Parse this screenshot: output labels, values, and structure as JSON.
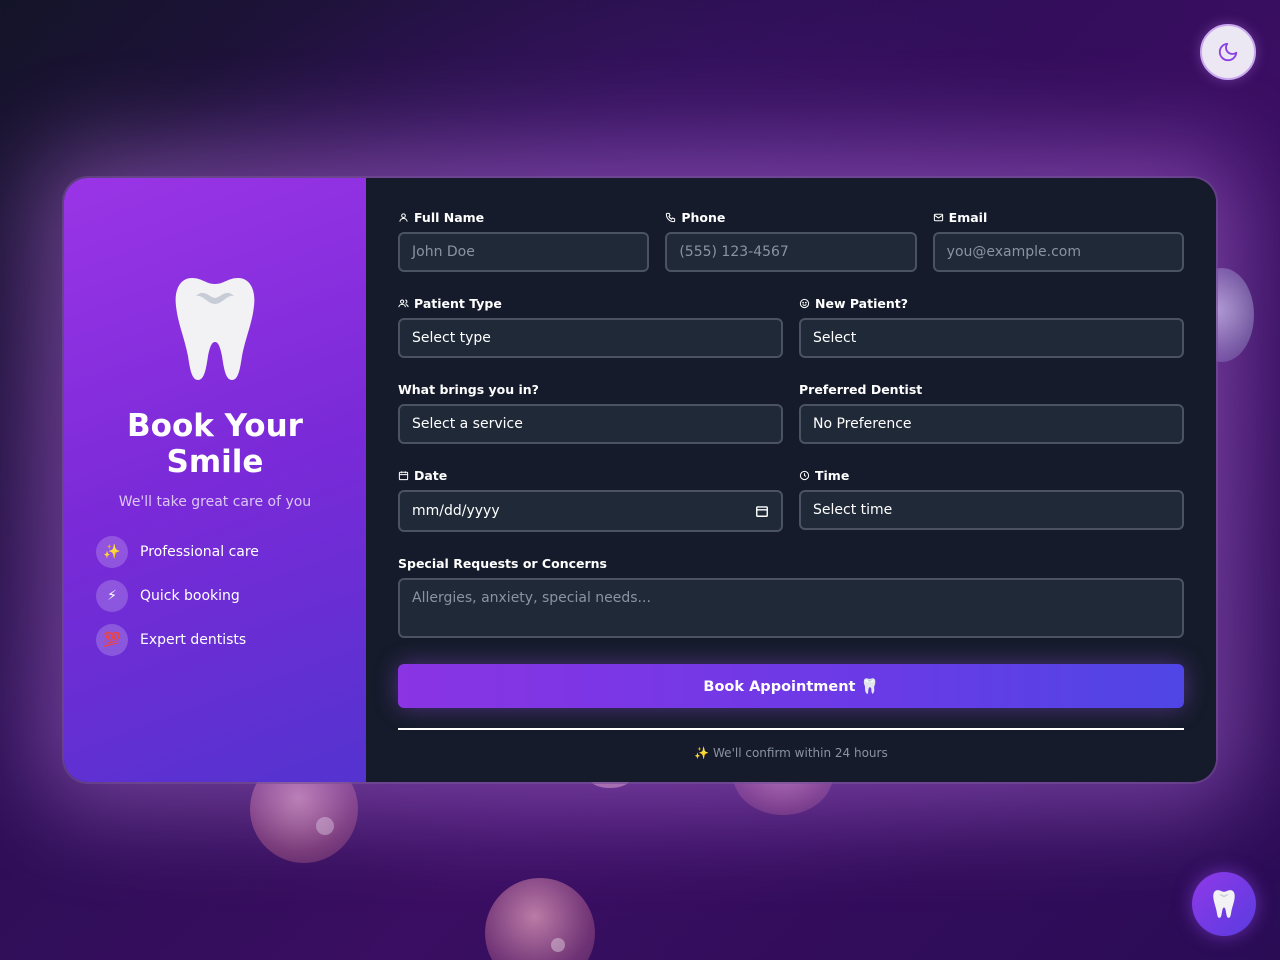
{
  "hero": {
    "title": "Book Your Smile",
    "subtitle": "We'll take great care of you",
    "features": [
      {
        "icon": "✨",
        "label": "Professional care"
      },
      {
        "icon": "⚡",
        "label": "Quick booking"
      },
      {
        "icon": "💯",
        "label": "Expert dentists"
      }
    ]
  },
  "form": {
    "full_name": {
      "label": "Full Name",
      "placeholder": "John Doe"
    },
    "phone": {
      "label": "Phone",
      "placeholder": "(555) 123-4567"
    },
    "email": {
      "label": "Email",
      "placeholder": "you@example.com"
    },
    "patient_type": {
      "label": "Patient Type",
      "value": "Select type"
    },
    "new_patient": {
      "label": "New Patient?",
      "value": "Select"
    },
    "service": {
      "label": "What brings you in?",
      "value": "Select a service"
    },
    "dentist": {
      "label": "Preferred Dentist",
      "value": "No Preference"
    },
    "date": {
      "label": "Date",
      "placeholder": "mm/dd/yyyy"
    },
    "time": {
      "label": "Time",
      "value": "Select time"
    },
    "requests": {
      "label": "Special Requests or Concerns",
      "placeholder": "Allergies, anxiety, special needs..."
    },
    "submit_label": "Book Appointment 🦷",
    "confirm_note": "✨ We'll confirm within 24 hours"
  },
  "icons": {
    "theme_toggle": "moon-icon",
    "fab": "tooth-icon"
  },
  "colors": {
    "accent_purple": "#8a34e4",
    "accent_indigo": "#4f46e5",
    "panel_dark": "#151b2a",
    "input_bg": "#1f2937"
  }
}
